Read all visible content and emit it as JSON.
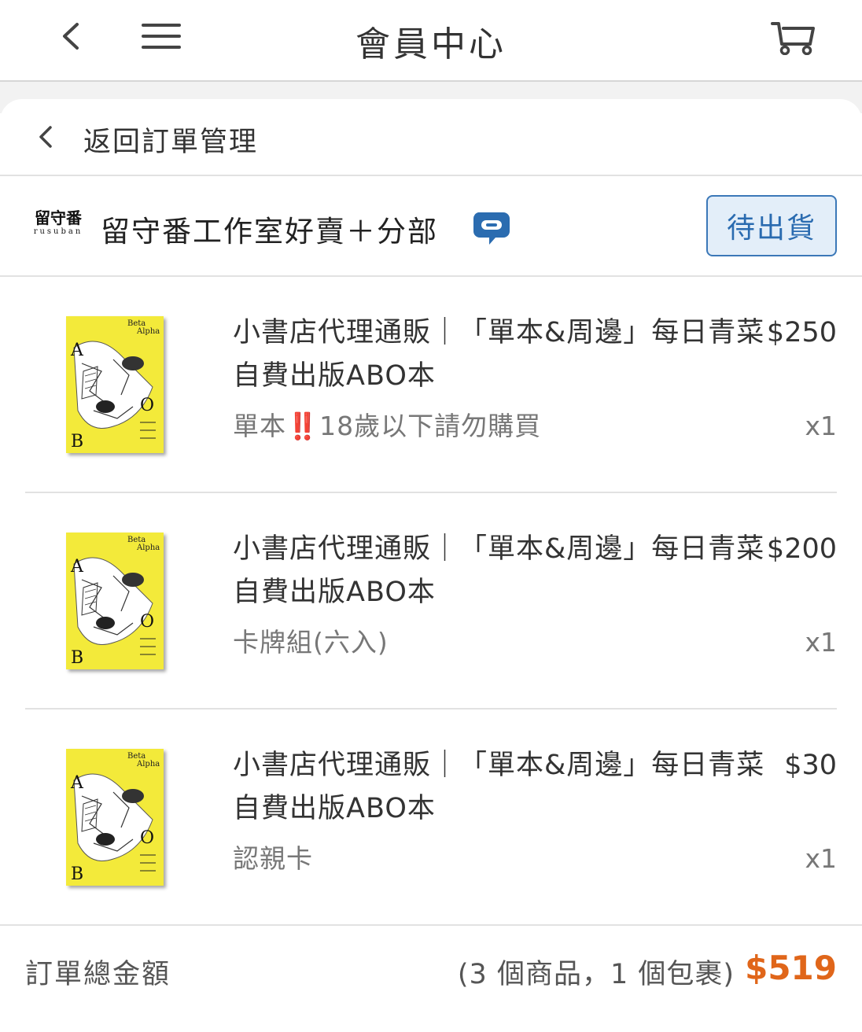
{
  "header": {
    "title": "會員中心",
    "back_icon": "chevron-left-icon",
    "menu_icon": "hamburger-menu-icon",
    "cart_icon": "cart-icon"
  },
  "back_link": {
    "label": "返回訂單管理"
  },
  "shop": {
    "logo_text": "留守番",
    "logo_subtext": "rusuban",
    "name": "留守番工作室好賣＋分部",
    "chat_icon": "chat-bubble-icon",
    "chat_color": "#2b6cb0",
    "status": "待出貨"
  },
  "items": [
    {
      "title": "小書店代理通販｜「單本&周邊」每日青菜自費出版ABO本",
      "price": "$250",
      "variant_prefix": "單本",
      "variant_mark": "‼️",
      "variant_suffix": "18歲以下請勿購買",
      "qty": "x1"
    },
    {
      "title": "小書店代理通販｜「單本&周邊」每日青菜自費出版ABO本",
      "price": "$200",
      "variant_prefix": "卡牌組(六入)",
      "variant_mark": "",
      "variant_suffix": "",
      "qty": "x1"
    },
    {
      "title": "小書店代理通販｜「單本&周邊」每日青菜自費出版ABO本",
      "price": "$30",
      "variant_prefix": "認親卡",
      "variant_mark": "",
      "variant_suffix": "",
      "qty": "x1"
    }
  ],
  "cover": {
    "beta": "Beta",
    "alpha": "Alpha",
    "a": "A",
    "o": "O",
    "b": "B",
    "bg_color": "#f3ea3a"
  },
  "total": {
    "label": "訂單總金額",
    "summary": "(3 個商品，1 個包裹)",
    "amount": "$519",
    "amount_color": "#e0661a"
  }
}
